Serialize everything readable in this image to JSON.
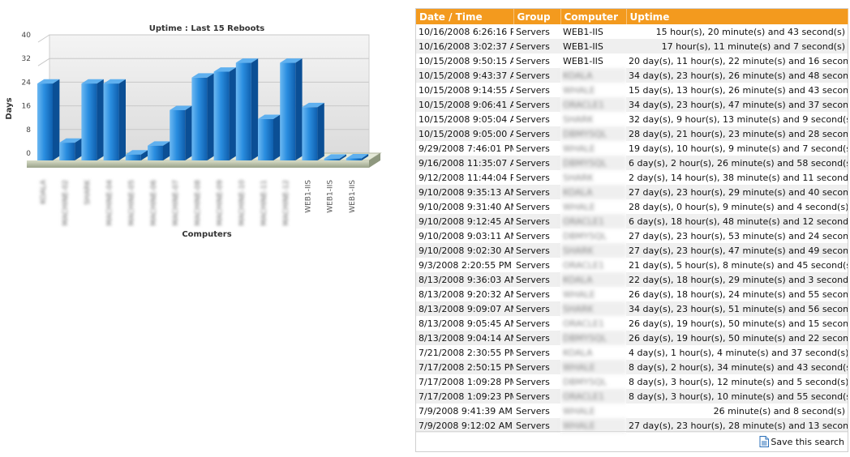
{
  "chart_data": {
    "type": "bar",
    "title": "Uptime : Last 15 Reboots",
    "xlabel": "Computers",
    "ylabel": "Days",
    "ylim": [
      0,
      40
    ],
    "yticks": [
      0,
      8,
      16,
      24,
      32,
      40
    ],
    "grid": true,
    "bar_color": "#1e7fd4",
    "categories": [
      "KOALA",
      "MACHINE-02",
      "SHARK",
      "MACHINE-04",
      "MACHINE-05",
      "MACHINE-06",
      "MACHINE-07",
      "MACHINE-08",
      "MACHINE-09",
      "MACHINE-10",
      "MACHINE-11",
      "MACHINE-12",
      "WEB1-IIS",
      "WEB1-IIS",
      "WEB1-IIS"
    ],
    "category_blurred": [
      true,
      true,
      true,
      true,
      true,
      true,
      true,
      true,
      true,
      true,
      true,
      true,
      false,
      false,
      false
    ],
    "values": [
      26,
      6,
      26,
      26,
      2,
      5,
      17,
      28,
      30,
      33,
      14,
      33,
      18,
      0.6,
      0.7
    ]
  },
  "table": {
    "headers": [
      "Date / Time",
      "Group",
      "Computer",
      "Uptime"
    ],
    "header_color": "#f39a1e",
    "rows": [
      {
        "date": "10/16/2008 6:26:16 PM",
        "group": "Servers",
        "computer": "WEB1-IIS",
        "blurred": false,
        "uptime": "15 hour(s), 20 minute(s) and 43 second(s)"
      },
      {
        "date": "10/16/2008 3:02:37 AM",
        "group": "Servers",
        "computer": "WEB1-IIS",
        "blurred": false,
        "uptime": "17 hour(s), 11 minute(s) and 7 second(s)"
      },
      {
        "date": "10/15/2008 9:50:15 AM",
        "group": "Servers",
        "computer": "WEB1-IIS",
        "blurred": false,
        "uptime": "20 day(s), 11 hour(s), 22 minute(s) and 16 second(s)"
      },
      {
        "date": "10/15/2008 9:43:37 AM",
        "group": "Servers",
        "computer": "KOALA",
        "blurred": true,
        "uptime": "34 day(s), 23 hour(s), 26 minute(s) and 48 second(s)"
      },
      {
        "date": "10/15/2008 9:14:55 AM",
        "group": "Servers",
        "computer": "WHALE",
        "blurred": true,
        "uptime": "15 day(s), 13 hour(s), 26 minute(s) and 43 second(s)"
      },
      {
        "date": "10/15/2008 9:06:41 AM",
        "group": "Servers",
        "computer": "ORACLE1",
        "blurred": true,
        "uptime": "34 day(s), 23 hour(s), 47 minute(s) and 37 second(s)"
      },
      {
        "date": "10/15/2008 9:05:04 AM",
        "group": "Servers",
        "computer": "SHARK",
        "blurred": true,
        "uptime": "32 day(s), 9 hour(s), 13 minute(s) and 9 second(s)"
      },
      {
        "date": "10/15/2008 9:05:00 AM",
        "group": "Servers",
        "computer": "DBMYSQL",
        "blurred": true,
        "uptime": "28 day(s), 21 hour(s), 23 minute(s) and 28 second(s)"
      },
      {
        "date": "9/29/2008 7:46:01 PM",
        "group": "Servers",
        "computer": "WHALE",
        "blurred": true,
        "uptime": "19 day(s), 10 hour(s), 9 minute(s) and 7 second(s)"
      },
      {
        "date": "9/16/2008 11:35:07 AM",
        "group": "Servers",
        "computer": "DBMYSQL",
        "blurred": true,
        "uptime": "6 day(s), 2 hour(s), 26 minute(s) and 58 second(s)"
      },
      {
        "date": "9/12/2008 11:44:04 PM",
        "group": "Servers",
        "computer": "SHARK",
        "blurred": true,
        "uptime": "2 day(s), 14 hour(s), 38 minute(s) and 11 second(s)"
      },
      {
        "date": "9/10/2008 9:35:13 AM",
        "group": "Servers",
        "computer": "KOALA",
        "blurred": true,
        "uptime": "27 day(s), 23 hour(s), 29 minute(s) and 40 second(s)"
      },
      {
        "date": "9/10/2008 9:31:40 AM",
        "group": "Servers",
        "computer": "WHALE",
        "blurred": true,
        "uptime": "28 day(s), 0 hour(s), 9 minute(s) and 4 second(s)"
      },
      {
        "date": "9/10/2008 9:12:45 AM",
        "group": "Servers",
        "computer": "ORACLE1",
        "blurred": true,
        "uptime": "6 day(s), 18 hour(s), 48 minute(s) and 12 second(s)"
      },
      {
        "date": "9/10/2008 9:03:11 AM",
        "group": "Servers",
        "computer": "DBMYSQL",
        "blurred": true,
        "uptime": "27 day(s), 23 hour(s), 53 minute(s) and 24 second(s)"
      },
      {
        "date": "9/10/2008 9:02:30 AM",
        "group": "Servers",
        "computer": "SHARK",
        "blurred": true,
        "uptime": "27 day(s), 23 hour(s), 47 minute(s) and 49 second(s)"
      },
      {
        "date": "9/3/2008 2:20:55 PM",
        "group": "Servers",
        "computer": "ORACLE1",
        "blurred": true,
        "uptime": "21 day(s), 5 hour(s), 8 minute(s) and 45 second(s)"
      },
      {
        "date": "8/13/2008 9:36:03 AM",
        "group": "Servers",
        "computer": "KOALA",
        "blurred": true,
        "uptime": "22 day(s), 18 hour(s), 29 minute(s) and 3 second(s)"
      },
      {
        "date": "8/13/2008 9:20:32 AM",
        "group": "Servers",
        "computer": "WHALE",
        "blurred": true,
        "uptime": "26 day(s), 18 hour(s), 24 minute(s) and 55 second(s)"
      },
      {
        "date": "8/13/2008 9:09:07 AM",
        "group": "Servers",
        "computer": "SHARK",
        "blurred": true,
        "uptime": "34 day(s), 23 hour(s), 51 minute(s) and 56 second(s)"
      },
      {
        "date": "8/13/2008 9:05:45 AM",
        "group": "Servers",
        "computer": "ORACLE1",
        "blurred": true,
        "uptime": "26 day(s), 19 hour(s), 50 minute(s) and 15 second(s)"
      },
      {
        "date": "8/13/2008 9:04:14 AM",
        "group": "Servers",
        "computer": "DBMYSQL",
        "blurred": true,
        "uptime": "26 day(s), 19 hour(s), 50 minute(s) and 22 second(s)"
      },
      {
        "date": "7/21/2008 2:30:55 PM",
        "group": "Servers",
        "computer": "KOALA",
        "blurred": true,
        "uptime": "4 day(s), 1 hour(s), 4 minute(s) and 37 second(s)"
      },
      {
        "date": "7/17/2008 2:50:15 PM",
        "group": "Servers",
        "computer": "WHALE",
        "blurred": true,
        "uptime": "8 day(s), 2 hour(s), 34 minute(s) and 43 second(s)"
      },
      {
        "date": "7/17/2008 1:09:28 PM",
        "group": "Servers",
        "computer": "DBMYSQL",
        "blurred": true,
        "uptime": "8 day(s), 3 hour(s), 12 minute(s) and 5 second(s)"
      },
      {
        "date": "7/17/2008 1:09:23 PM",
        "group": "Servers",
        "computer": "ORACLE1",
        "blurred": true,
        "uptime": "8 day(s), 3 hour(s), 10 minute(s) and 55 second(s)"
      },
      {
        "date": "7/9/2008 9:41:39 AM",
        "group": "Servers",
        "computer": "WHALE",
        "blurred": true,
        "uptime": "26 minute(s) and 8 second(s)"
      },
      {
        "date": "7/9/2008 9:12:02 AM",
        "group": "Servers",
        "computer": "WHALE",
        "blurred": true,
        "uptime": "27 day(s), 23 hour(s), 28 minute(s) and 13 second(s)"
      }
    ]
  },
  "footer": {
    "save_label": "Save this search",
    "save_icon": "document-icon"
  }
}
